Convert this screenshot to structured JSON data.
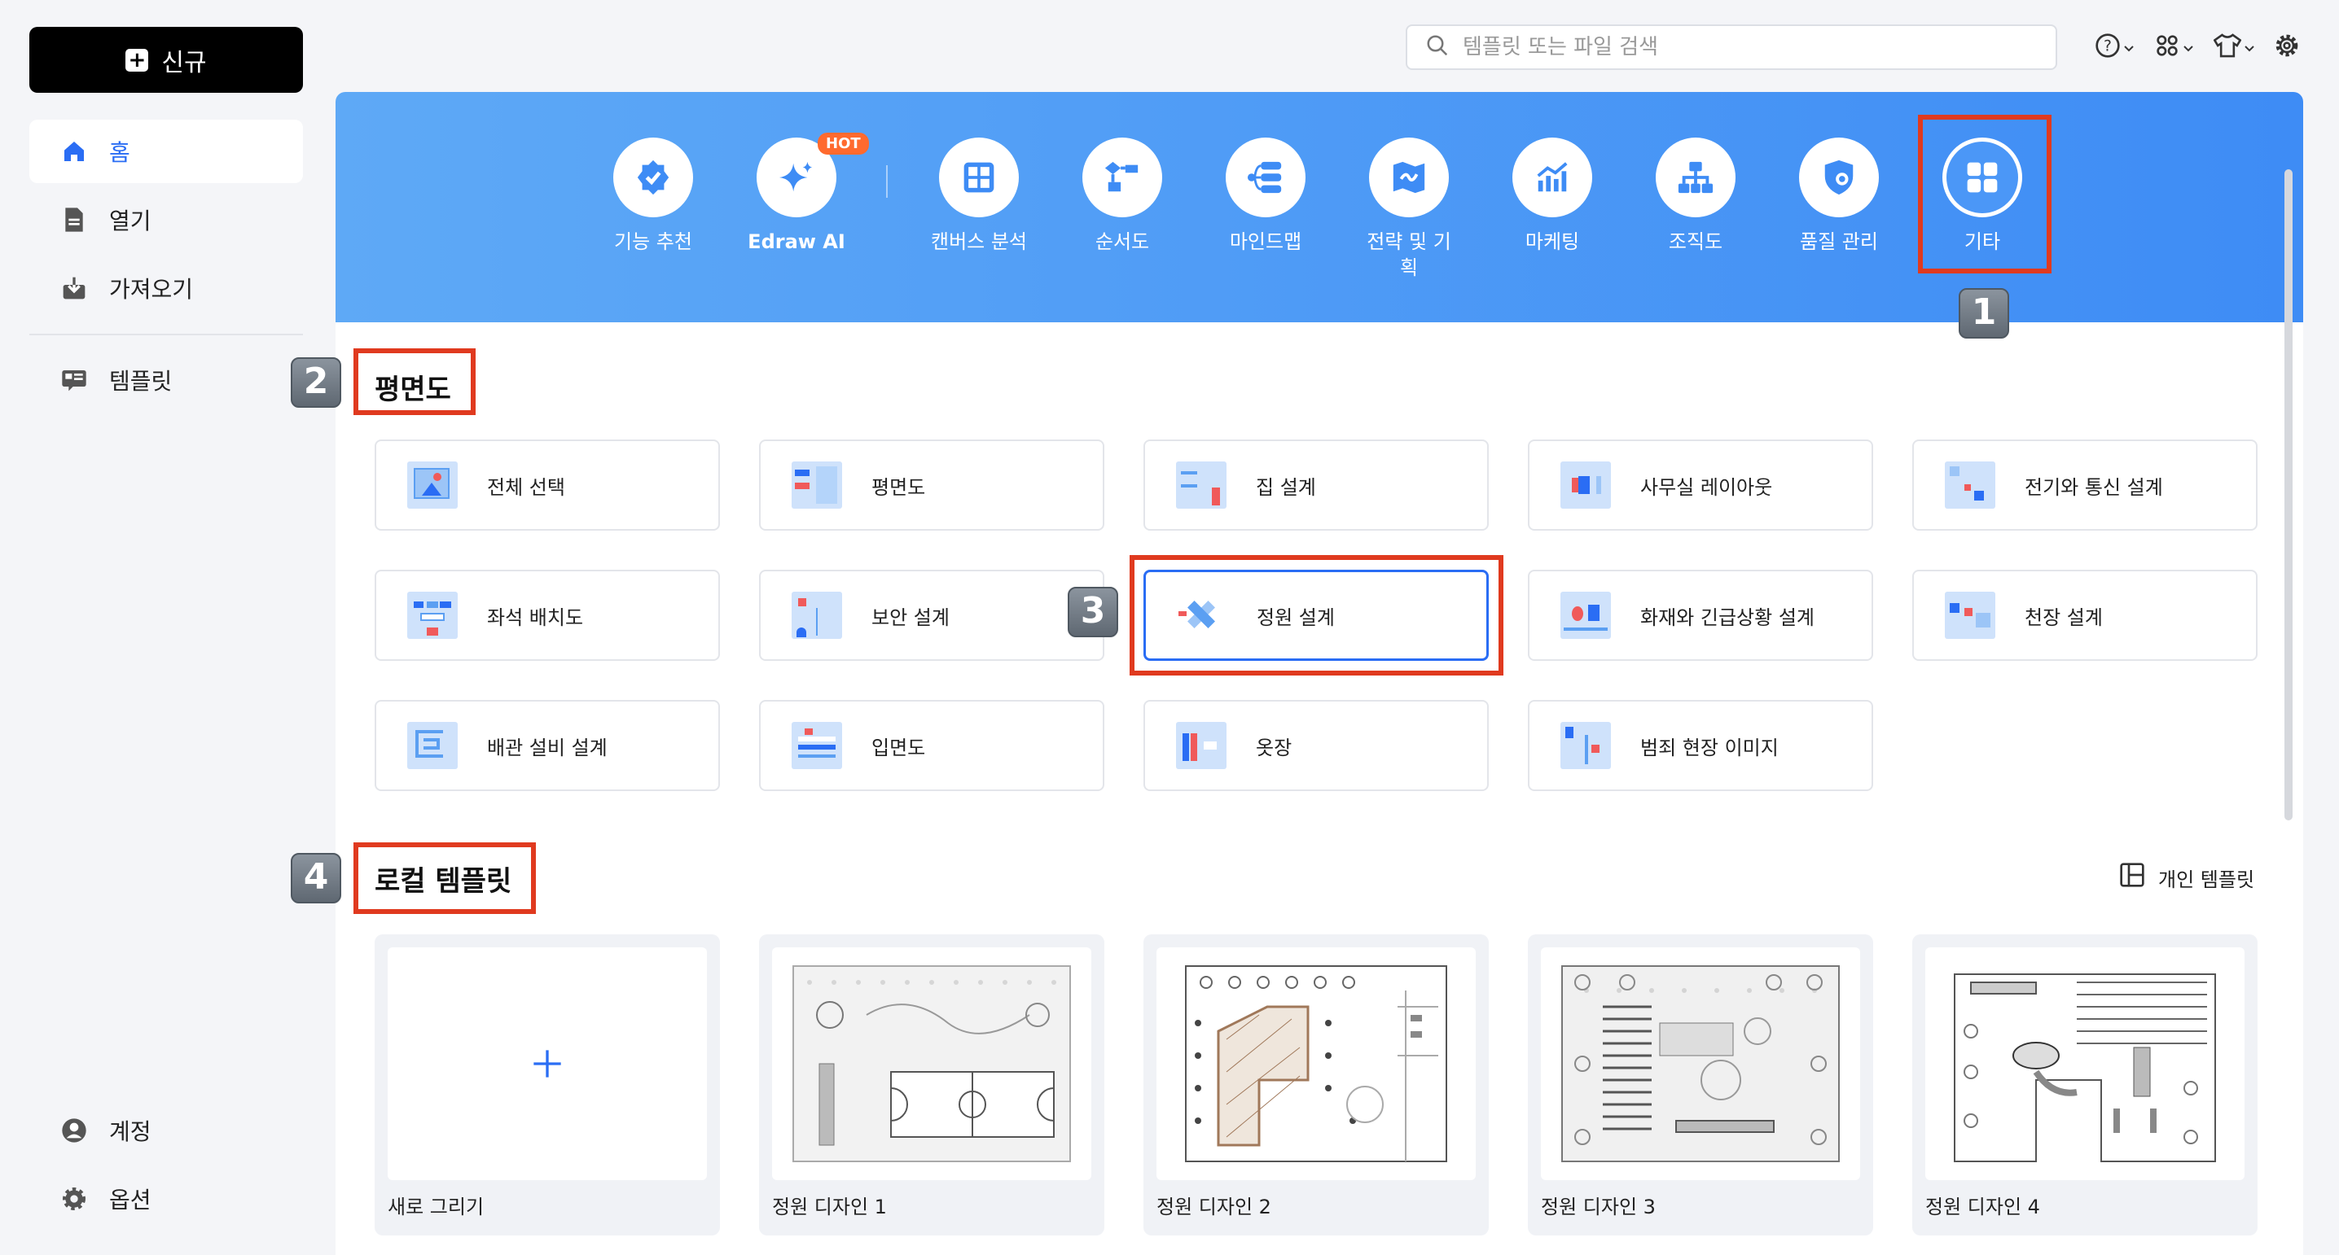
{
  "sidebar": {
    "new_label": "신규",
    "items": [
      {
        "label": "홈"
      },
      {
        "label": "열기"
      },
      {
        "label": "가져오기"
      },
      {
        "label": "템플릿"
      }
    ],
    "bottom": [
      {
        "label": "계정"
      },
      {
        "label": "옵션"
      }
    ]
  },
  "search": {
    "placeholder": "템플릿 또는 파일 검색"
  },
  "categories": [
    {
      "label": "기능 추천"
    },
    {
      "label": "Edraw AI"
    },
    {
      "label": "캔버스 분석"
    },
    {
      "label": "순서도"
    },
    {
      "label": "마인드맵"
    },
    {
      "label": "전략 및 기획"
    },
    {
      "label": "마케팅"
    },
    {
      "label": "조직도"
    },
    {
      "label": "품질 관리"
    },
    {
      "label": "기타"
    }
  ],
  "hot_badge": "HOT",
  "section1": {
    "title": "평면도",
    "cards": [
      {
        "label": "전체 선택"
      },
      {
        "label": "평면도"
      },
      {
        "label": "집 설계"
      },
      {
        "label": "사무실 레이아웃"
      },
      {
        "label": "전기와 통신 설계"
      },
      {
        "label": "좌석 배치도"
      },
      {
        "label": "보안 설계"
      },
      {
        "label": "정원 설계"
      },
      {
        "label": "화재와 긴급상황 설계"
      },
      {
        "label": "천장 설계"
      },
      {
        "label": "배관 설비 설계"
      },
      {
        "label": "입면도"
      },
      {
        "label": "옷장"
      },
      {
        "label": "범죄 현장 이미지"
      }
    ]
  },
  "section2": {
    "title": "로컬 템플릿",
    "personal_label": "개인 템플릿",
    "templates": [
      {
        "name": "새로 그리기"
      },
      {
        "name": "정원 디자인 1"
      },
      {
        "name": "정원 디자인 2"
      },
      {
        "name": "정원 디자인 3"
      },
      {
        "name": "정원 디자인 4"
      }
    ]
  },
  "badges": [
    "1",
    "2",
    "3",
    "4"
  ],
  "colors": {
    "accent": "#2a6df4",
    "annotation_red": "#e03a1f",
    "banner_start": "#5ea9f6",
    "banner_end": "#3e8cf5"
  }
}
